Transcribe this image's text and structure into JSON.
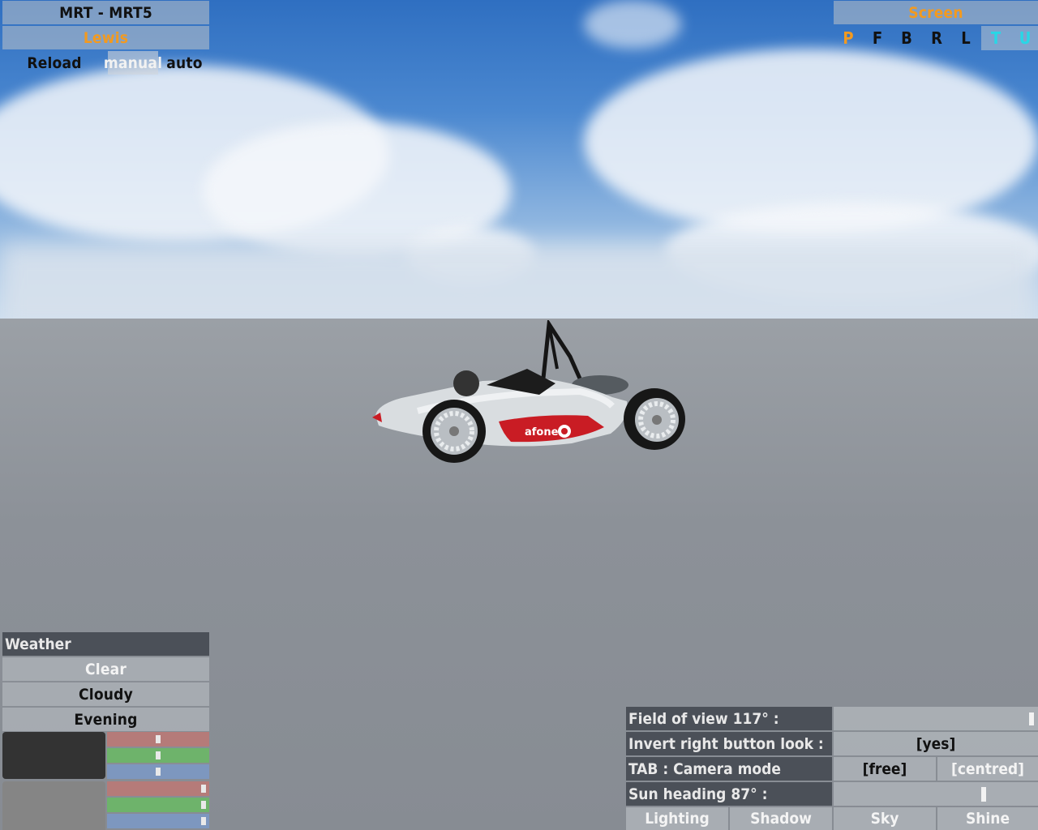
{
  "car": {
    "title": "MRT - MRT5",
    "driver": "Lewis",
    "reload": "Reload",
    "manual": "manual",
    "auto": "auto"
  },
  "screen": {
    "title": "Screen",
    "tabs": [
      {
        "label": "P",
        "color": "#f39a1f"
      },
      {
        "label": "F",
        "color": "#111111"
      },
      {
        "label": "B",
        "color": "#111111"
      },
      {
        "label": "R",
        "color": "#111111"
      },
      {
        "label": "L",
        "color": "#111111"
      },
      {
        "label": "T",
        "color": "#28d7e6"
      },
      {
        "label": "U",
        "color": "#28d7e6"
      }
    ]
  },
  "weather": {
    "header": "Weather",
    "options": [
      "Clear",
      "Cloudy",
      "Evening"
    ],
    "presets": [
      {
        "swatch_color": "#333333",
        "red": 0.5,
        "green": 0.5,
        "blue": 0.5
      },
      {
        "swatch_color": "#858585",
        "red": 0.97,
        "green": 0.97,
        "blue": 0.97
      }
    ]
  },
  "settings": {
    "fov_label": "Field of view 117° :",
    "fov_value": 0.98,
    "invert_label": "Invert right button look :",
    "invert_value": "[yes]",
    "camera_label": "TAB : Camera mode",
    "camera_free": "[free]",
    "camera_centred": "[centred]",
    "sun_label": "Sun heading 87° :",
    "sun_value": 0.74,
    "buttons": [
      "Lighting",
      "Shadow",
      "Sky",
      "Shine"
    ]
  },
  "scene": {
    "car_brand_text": "afone"
  }
}
